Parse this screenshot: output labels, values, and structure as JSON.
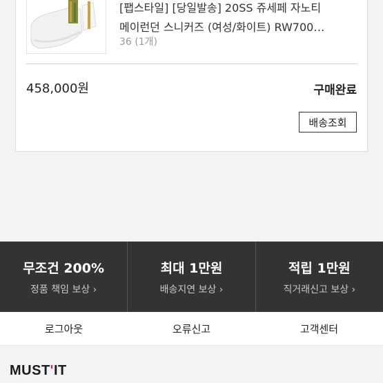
{
  "order": {
    "title_line1": "[팹스타일] [당일발송] 20SS 쥬세페 자노티",
    "title_line2": "메이런던 스니커즈 (여성/화이트) RW700…",
    "option": "36 (1개)",
    "price": "458,000원",
    "status": "구매완료",
    "track_button": "배송조회"
  },
  "benefits": [
    {
      "title": "무조건 200%",
      "subtitle": "정품 책임 보상 ›"
    },
    {
      "title": "최대 1만원",
      "subtitle": "배송지연 보상 ›"
    },
    {
      "title": "적립 1만원",
      "subtitle": "직거래신고 보상 ›"
    }
  ],
  "footer_links": {
    "logout": "로그아웃",
    "report_error": "오류신고",
    "customer_center": "고객센터"
  },
  "brand": {
    "logo_prefix": "MUST",
    "logo_mark": "'",
    "logo_suffix": "IT",
    "accent_color": "#e8205a"
  }
}
